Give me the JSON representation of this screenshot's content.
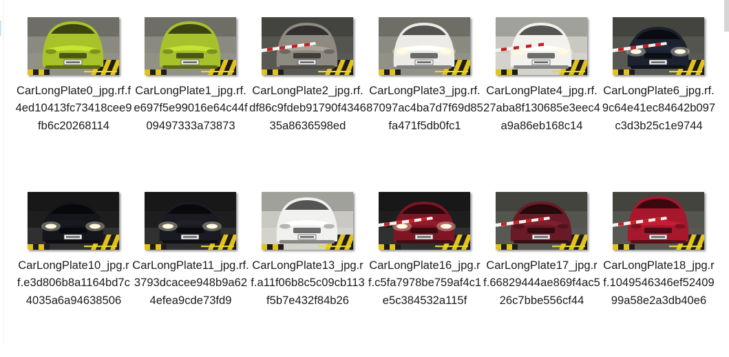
{
  "files": [
    {
      "name": "CarLongPlate0_jpg.rf.f4ed10413fc73418cee9fb6c20268114",
      "car_color": "#a8c22a",
      "car_style": "hatch",
      "lights": "off",
      "barrier": false,
      "scene": "lit"
    },
    {
      "name": "CarLongPlate1_jpg.rf.e697f5e99016e64c44f09497333a73873",
      "car_color": "#a6c12c",
      "car_style": "hatch",
      "lights": "off",
      "barrier": false,
      "scene": "lit"
    },
    {
      "name": "CarLongPlate2_jpg.rf.df86c9fdeb91790f434635a8636598ed",
      "car_color": "#8e8a82",
      "car_style": "suv",
      "lights": "off",
      "barrier": true,
      "scene": "dim"
    },
    {
      "name": "CarLongPlate3_jpg.rf.87097ac4ba7d7f69d85fa471f5db0fc1",
      "car_color": "#ecebe8",
      "car_style": "suv",
      "lights": "on",
      "barrier": false,
      "scene": "lit"
    },
    {
      "name": "CarLongPlate4_jpg.rf.27aba8f130685e3eec4a9a86eb168c14",
      "car_color": "#f3f2ef",
      "car_style": "suv",
      "lights": "on",
      "barrier": true,
      "scene": "bright"
    },
    {
      "name": "CarLongPlate6_jpg.rf.9c64e41ec84642b097c3d3b25c1e9744",
      "car_color": "#1d2230",
      "car_style": "sedan",
      "lights": "on",
      "barrier": true,
      "scene": "dim"
    },
    {
      "name": "CarLongPlate10_jpg.rf.e3d806b8a1164bd7c4035a6a94638506",
      "car_color": "#15161c",
      "car_style": "sedan",
      "lights": "on",
      "barrier": false,
      "scene": "dark"
    },
    {
      "name": "CarLongPlate11_jpg.rf.3793dcacee948b9a624efea9cde73fd9",
      "car_color": "#1a1b22",
      "car_style": "sedan",
      "lights": "on",
      "barrier": false,
      "scene": "dark"
    },
    {
      "name": "CarLongPlate13_jpg.rf.a11f06b8c5c09cb113f5b7e432f84b26",
      "car_color": "#f1f1ef",
      "car_style": "suv",
      "lights": "off",
      "barrier": false,
      "scene": "bright"
    },
    {
      "name": "CarLongPlate16_jpg.rf.c5fa7978be759af4c1e5c384532a115f",
      "car_color": "#7e1524",
      "car_style": "sedan",
      "lights": "on",
      "barrier": true,
      "scene": "dark"
    },
    {
      "name": "CarLongPlate17_jpg.rf.66829444ae869f4ac526c7bbe556cf44",
      "car_color": "#6a1a26",
      "car_style": "sedan",
      "lights": "off",
      "barrier": true,
      "scene": "dim"
    },
    {
      "name": "CarLongPlate18_jpg.rf.1049546346ef5240999a58e2a3db40e6",
      "car_color": "#a8182c",
      "car_style": "hatch",
      "lights": "off",
      "barrier": true,
      "scene": "dim"
    }
  ],
  "colors": {
    "floor_yellow": "#e3c21a",
    "floor_black": "#1c1c1c",
    "barrier_white": "#f2f2f2",
    "barrier_red": "#c61f1f",
    "plate_bg": "#e9ecec",
    "timestamp_yellow": "#e6d63a"
  }
}
